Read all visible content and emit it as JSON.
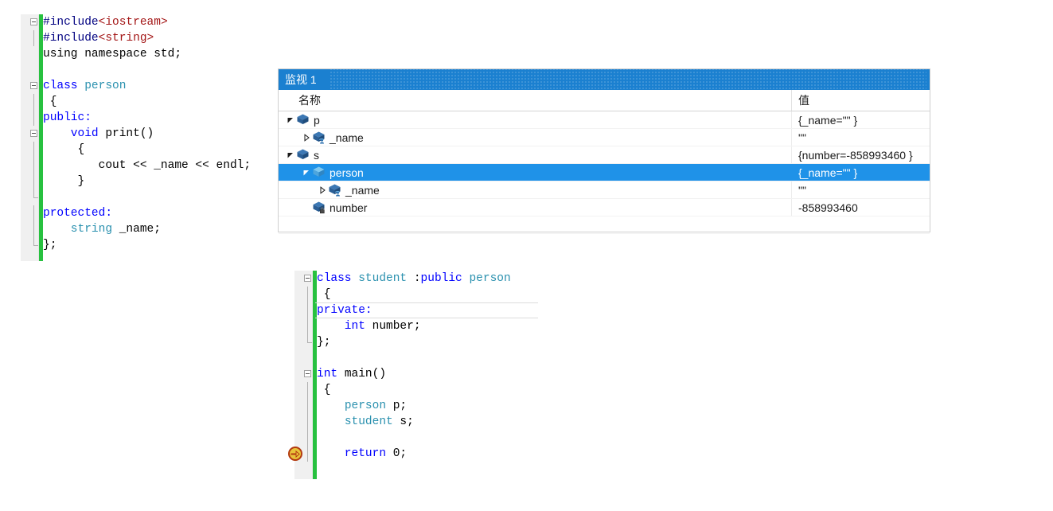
{
  "editor_top": {
    "name": "person-class-source",
    "lines": [
      {
        "indent": 0,
        "outline": "start",
        "tokens": [
          {
            "t": "#include",
            "c": "pp"
          },
          {
            "t": "<iostream>",
            "c": "inc"
          }
        ]
      },
      {
        "indent": 0,
        "outline": "mid",
        "tokens": [
          {
            "t": "#include",
            "c": "pp"
          },
          {
            "t": "<string>",
            "c": "inc"
          }
        ]
      },
      {
        "indent": 0,
        "outline": "none",
        "tokens": [
          {
            "t": "using namespace std;",
            "c": "plain"
          }
        ]
      },
      {
        "indent": 0,
        "outline": "none",
        "tokens": []
      },
      {
        "indent": 0,
        "outline": "start",
        "tokens": [
          {
            "t": "class ",
            "c": "kw"
          },
          {
            "t": "person",
            "c": "typ"
          }
        ]
      },
      {
        "indent": 0,
        "outline": "mid",
        "tokens": [
          {
            "t": " {",
            "c": "plain"
          }
        ]
      },
      {
        "indent": 0,
        "outline": "mid",
        "tokens": [
          {
            "t": "public:",
            "c": "kw"
          }
        ]
      },
      {
        "indent": 0,
        "outline": "start2",
        "tokens": [
          {
            "t": "    void ",
            "c": "kw"
          },
          {
            "t": "print()",
            "c": "plain"
          }
        ]
      },
      {
        "indent": 0,
        "outline": "mid",
        "tokens": [
          {
            "t": "     {",
            "c": "plain"
          }
        ]
      },
      {
        "indent": 0,
        "outline": "mid",
        "tokens": [
          {
            "t": "        cout << _name << endl;",
            "c": "plain"
          }
        ]
      },
      {
        "indent": 0,
        "outline": "mid",
        "tokens": [
          {
            "t": "     }",
            "c": "plain"
          }
        ]
      },
      {
        "indent": 0,
        "outline": "endmark",
        "tokens": []
      },
      {
        "indent": 0,
        "outline": "mid",
        "tokens": [
          {
            "t": "protected:",
            "c": "kw"
          }
        ]
      },
      {
        "indent": 0,
        "outline": "mid",
        "tokens": [
          {
            "t": "    string ",
            "c": "typ"
          },
          {
            "t": "_name;",
            "c": "plain"
          }
        ]
      },
      {
        "indent": 0,
        "outline": "end",
        "tokens": [
          {
            "t": "};",
            "c": "plain"
          }
        ]
      }
    ]
  },
  "editor_bottom": {
    "name": "student-main-source",
    "lines": [
      {
        "outline": "start",
        "current": false,
        "tokens": [
          {
            "t": "class ",
            "c": "kw"
          },
          {
            "t": "student",
            "c": "typ"
          },
          {
            "t": " :",
            "c": "plain"
          },
          {
            "t": "public ",
            "c": "kw"
          },
          {
            "t": "person",
            "c": "typ"
          }
        ]
      },
      {
        "outline": "mid",
        "current": false,
        "tokens": [
          {
            "t": " {",
            "c": "plain"
          }
        ]
      },
      {
        "outline": "mid",
        "current": true,
        "tokens": [
          {
            "t": "private:",
            "c": "kw"
          }
        ]
      },
      {
        "outline": "mid",
        "current": false,
        "tokens": [
          {
            "t": "    int ",
            "c": "kw"
          },
          {
            "t": "number;",
            "c": "plain"
          }
        ]
      },
      {
        "outline": "end",
        "current": false,
        "tokens": [
          {
            "t": "};",
            "c": "plain"
          }
        ]
      },
      {
        "outline": "none",
        "current": false,
        "tokens": []
      },
      {
        "outline": "start",
        "current": false,
        "tokens": [
          {
            "t": "int ",
            "c": "kw"
          },
          {
            "t": "main()",
            "c": "plain"
          }
        ]
      },
      {
        "outline": "mid",
        "current": false,
        "tokens": [
          {
            "t": " {",
            "c": "plain"
          }
        ]
      },
      {
        "outline": "mid",
        "current": false,
        "tokens": [
          {
            "t": "    ",
            "c": "plain"
          },
          {
            "t": "person",
            "c": "typ"
          },
          {
            "t": " p;",
            "c": "plain"
          }
        ]
      },
      {
        "outline": "mid",
        "current": false,
        "tokens": [
          {
            "t": "    ",
            "c": "plain"
          },
          {
            "t": "student",
            "c": "typ"
          },
          {
            "t": " s;",
            "c": "plain"
          }
        ]
      },
      {
        "outline": "mid",
        "current": false,
        "tokens": []
      },
      {
        "outline": "mid",
        "current": false,
        "exec": true,
        "tokens": [
          {
            "t": "    return ",
            "c": "kw"
          },
          {
            "t": "0;",
            "c": "plain"
          }
        ]
      }
    ]
  },
  "watch": {
    "title": "监视 1",
    "columns": {
      "name": "名称",
      "value": "值"
    },
    "rows": [
      {
        "depth": 0,
        "twisty": "expanded",
        "icon": "object-icon",
        "name": "p",
        "value": "{_name=\"\" }",
        "selected": false
      },
      {
        "depth": 1,
        "twisty": "collapsed",
        "icon": "field-protected-icon",
        "name": "_name",
        "value": "\"\"",
        "selected": false
      },
      {
        "depth": 0,
        "twisty": "expanded",
        "icon": "object-icon",
        "name": "s",
        "value": "{number=-858993460 }",
        "selected": false
      },
      {
        "depth": 1,
        "twisty": "expanded",
        "icon": "base-class-icon",
        "name": "person",
        "value": "{_name=\"\" }",
        "selected": true
      },
      {
        "depth": 2,
        "twisty": "collapsed",
        "icon": "field-protected-icon",
        "name": "_name",
        "value": "\"\"",
        "selected": false
      },
      {
        "depth": 1,
        "twisty": "none",
        "icon": "field-private-icon",
        "name": "number",
        "value": "-858993460",
        "selected": false
      }
    ]
  },
  "colors": {
    "title_bar": "#1b80d0",
    "selection": "#1f92e8",
    "change_bar": "#27c13f",
    "keyword": "#0000ff",
    "type": "#2b91af",
    "preprocessor": "#000080",
    "include_string": "#a31515"
  }
}
